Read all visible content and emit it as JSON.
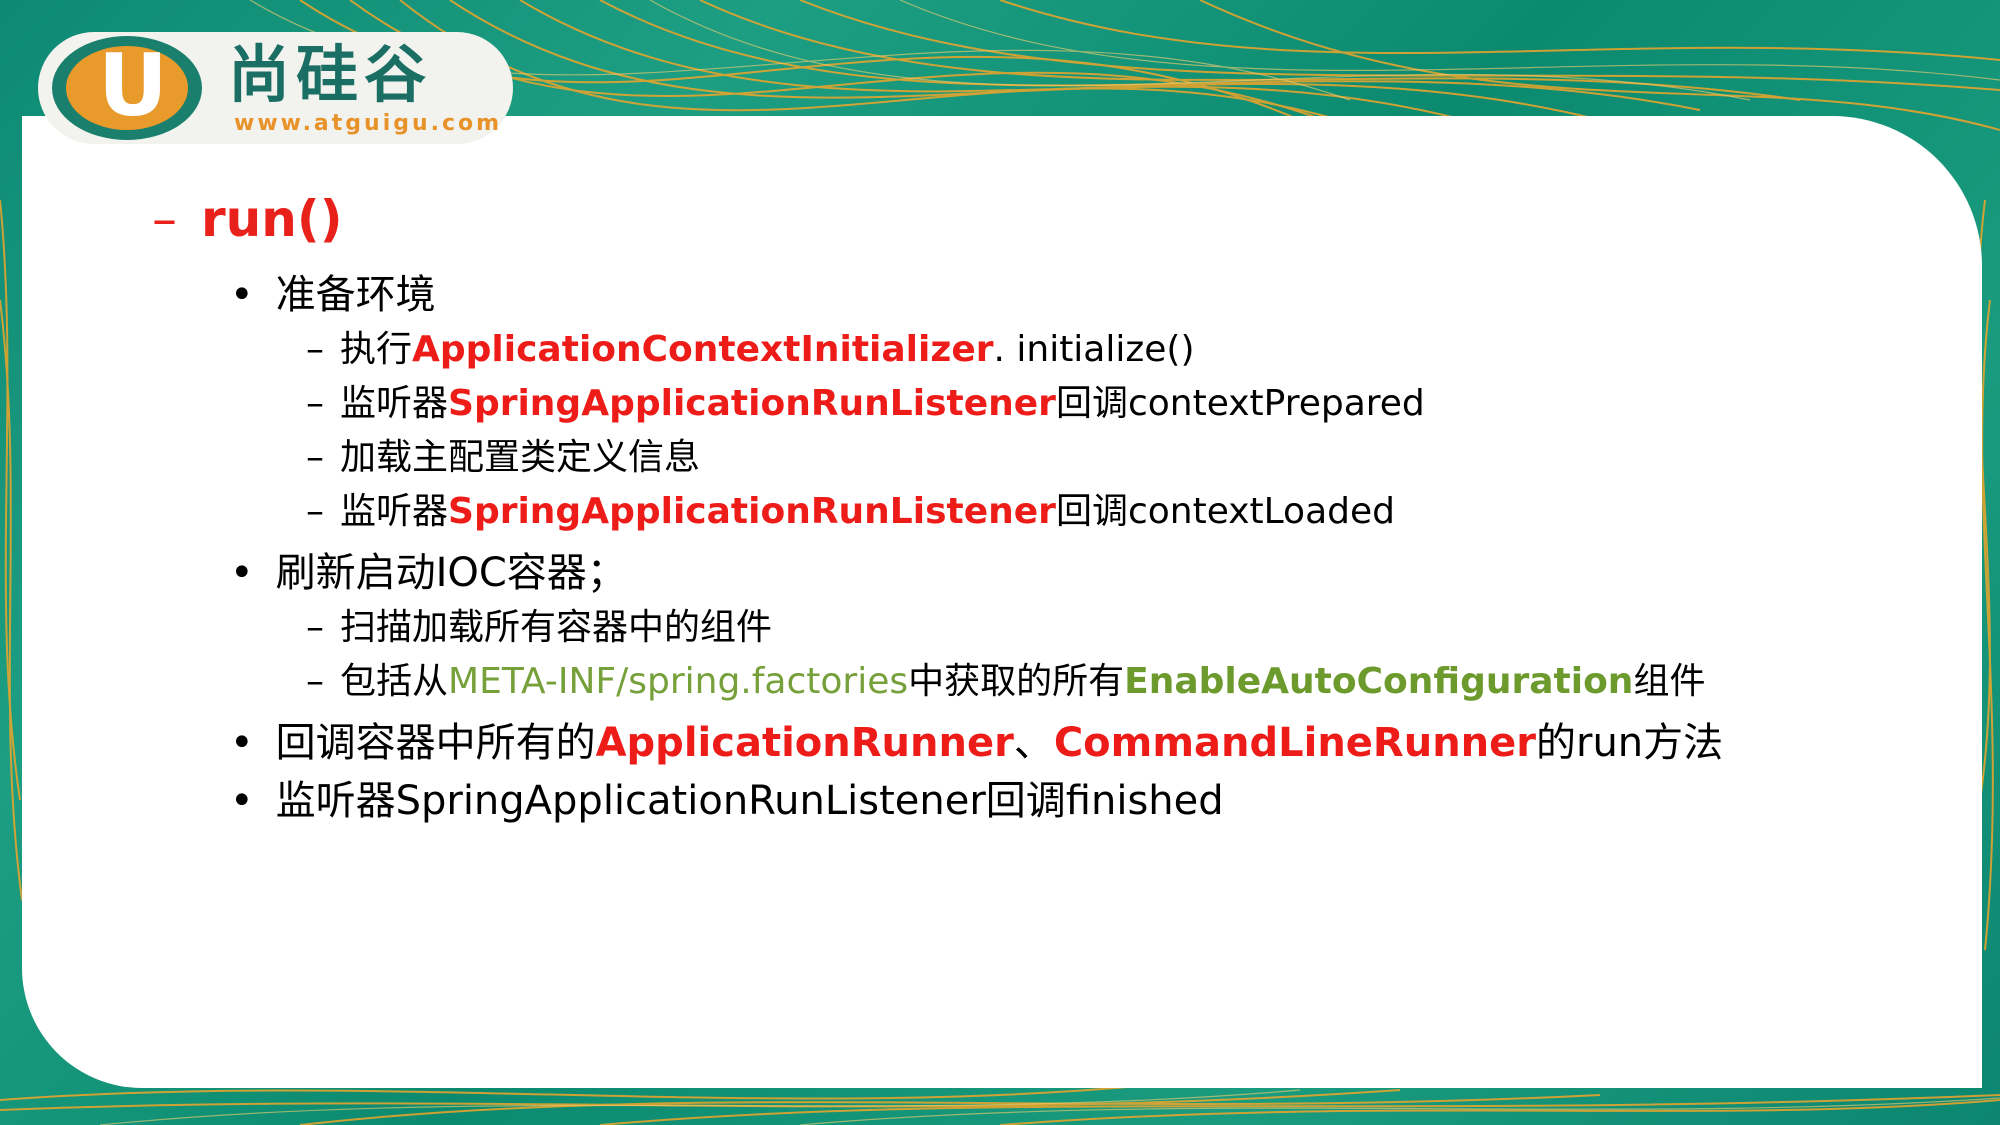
{
  "logo": {
    "letter": "U",
    "brand": "尚硅谷",
    "url": "www.atguigu.com"
  },
  "slide": {
    "heading": {
      "marker": "–",
      "text": "run()"
    },
    "items": [
      {
        "marker": "•",
        "text": "准备环境",
        "children": [
          {
            "marker": "–",
            "prefix": "执行",
            "highlight": "ApplicationContextInitializer",
            "suffix": ". initialize()"
          },
          {
            "marker": "–",
            "prefix": "监听器",
            "highlight": "SpringApplicationRunListener",
            "suffix": "回调contextPrepared"
          },
          {
            "marker": "–",
            "text": "加载主配置类定义信息"
          },
          {
            "marker": "–",
            "prefix": "监听器",
            "highlight": "SpringApplicationRunListener",
            "suffix": "回调contextLoaded"
          }
        ]
      },
      {
        "marker": "•",
        "text": "刷新启动IOC容器；",
        "children": [
          {
            "marker": "–",
            "text": "扫描加载所有容器中的组件"
          },
          {
            "marker": "–",
            "prefix": "包括从",
            "green": "META-INF/spring.factories",
            "middle": "中获取的所有",
            "green_bold": "EnableAutoConfiguration",
            "suffix": "组件"
          }
        ]
      },
      {
        "marker": "•",
        "prefix": "回调容器中所有的",
        "highlight1": "ApplicationRunner",
        "sep": "、",
        "highlight2": "CommandLineRunner",
        "suffix": "的run方法"
      },
      {
        "marker": "•",
        "text": "监听器SpringApplicationRunListener回调finished"
      }
    ]
  },
  "colors": {
    "background": "#0e8a74",
    "accent_orange": "#e8932a",
    "highlight_red": "#ee1c18",
    "highlight_green": "#76a03a"
  }
}
